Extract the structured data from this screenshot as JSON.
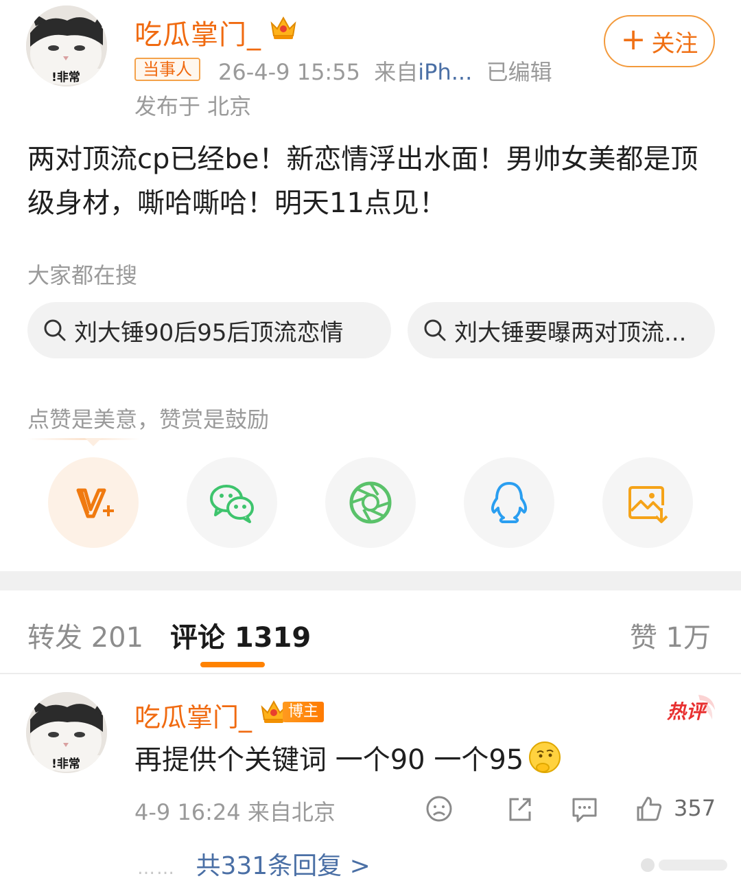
{
  "post": {
    "author": "吃瓜掌门_",
    "role_badge": "当事人",
    "meta_time": "26-4-9 15:55",
    "meta_from_prefix": "来自",
    "meta_source": "iPh...",
    "meta_edited": "已编辑",
    "location": "发布于 北京",
    "follow_label": "关注",
    "text": "两对顶流cp已经be！新恋情浮出水面！男帅女美都是顶级身材，嘶哈嘶哈！明天11点见！"
  },
  "search": {
    "label": "大家都在搜",
    "chips": [
      "刘大锤90后95后顶流恋情",
      "刘大锤要曝两对顶流..."
    ]
  },
  "reward": {
    "label": "点赞是美意，赞赏是鼓励",
    "share_icons": [
      "weibo-v-plus-icon",
      "wechat-icon",
      "moments-icon",
      "qq-icon",
      "save-image-icon"
    ]
  },
  "tabs": {
    "repost": "转发 201",
    "comments": "评论 1319",
    "likes": "赞 1万"
  },
  "comment": {
    "author": "吃瓜掌门_",
    "badge": "博主",
    "hot_tag": "热评",
    "text": "再提供个关键词 一个90 一个95",
    "meta": "4-9 16:24 来自北京",
    "like_count": "357",
    "replies_dots": "……",
    "replies": "共331条回复 >"
  },
  "colors": {
    "accent": "#f06a10",
    "link": "#4a6fa5",
    "tab_underline": "#ff8200"
  }
}
